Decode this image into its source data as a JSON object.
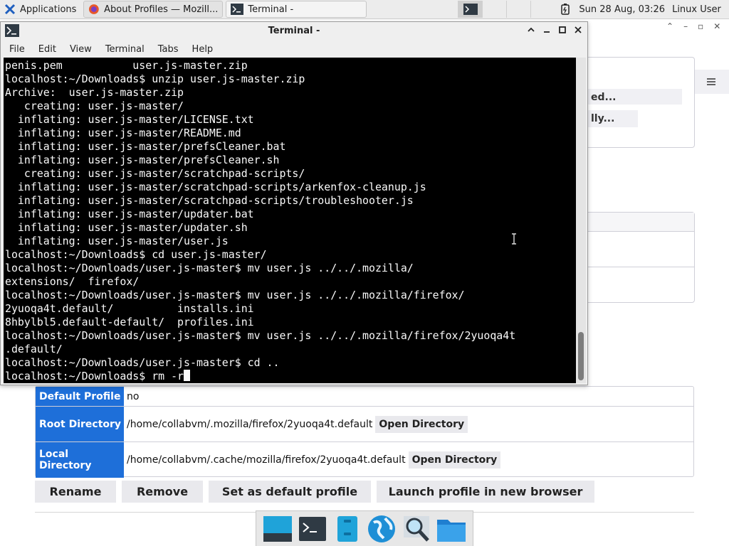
{
  "panel": {
    "applications_label": "Applications",
    "tasks": [
      {
        "label": "About Profiles — Mozill..."
      },
      {
        "label": "Terminal -"
      }
    ],
    "clock": "Sun 28 Aug, 03:26",
    "user": "Linux User"
  },
  "terminal": {
    "title": "Terminal -",
    "menu": [
      "File",
      "Edit",
      "View",
      "Terminal",
      "Tabs",
      "Help"
    ],
    "lines": [
      "penis.pem           user.js-master.zip",
      "localhost:~/Downloads$ unzip user.js-master.zip",
      "Archive:  user.js-master.zip",
      "   creating: user.js-master/",
      "  inflating: user.js-master/LICENSE.txt",
      "  inflating: user.js-master/README.md",
      "  inflating: user.js-master/prefsCleaner.bat",
      "  inflating: user.js-master/prefsCleaner.sh",
      "   creating: user.js-master/scratchpad-scripts/",
      "  inflating: user.js-master/scratchpad-scripts/arkenfox-cleanup.js",
      "  inflating: user.js-master/scratchpad-scripts/troubleshooter.js",
      "  inflating: user.js-master/updater.bat",
      "  inflating: user.js-master/updater.sh",
      "  inflating: user.js-master/user.js",
      "localhost:~/Downloads$ cd user.js-master/",
      "localhost:~/Downloads/user.js-master$ mv user.js ../../.mozilla/",
      "extensions/  firefox/",
      "localhost:~/Downloads/user.js-master$ mv user.js ../../.mozilla/firefox/",
      "2yuoqa4t.default/          installs.ini",
      "8hbylbl5.default-default/  profiles.ini",
      "localhost:~/Downloads/user.js-master$ mv user.js ../../.mozilla/firefox/2yuoqa4t",
      ".default/",
      "localhost:~/Downloads/user.js-master$ cd ..",
      "localhost:~/Downloads$ rm -r"
    ]
  },
  "firefox": {
    "partial_buttons": [
      "ed...",
      "lly..."
    ],
    "profile_rows": [
      {
        "key": "Default Profile",
        "value": "no"
      },
      {
        "key": "Root Directory",
        "value": "/home/collabvm/.mozilla/firefox/2yuoqa4t.default",
        "button": "Open Directory"
      },
      {
        "key": "Local Directory",
        "value": "/home/collabvm/.cache/mozilla/firefox/2yuoqa4t.default",
        "button": "Open Directory"
      }
    ],
    "actions": [
      "Rename",
      "Remove",
      "Set as default profile",
      "Launch profile in new browser"
    ]
  }
}
